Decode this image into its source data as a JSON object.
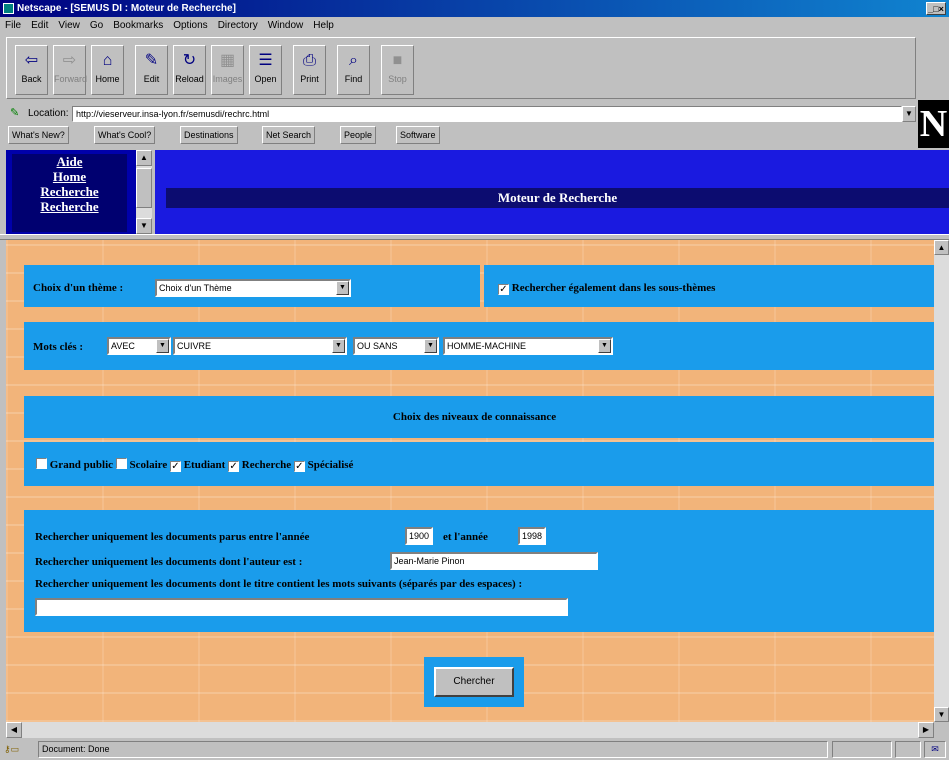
{
  "window": {
    "title": "Netscape - [SEMUS DI : Moteur de Recherche]",
    "controls": "_□×"
  },
  "menu": [
    "File",
    "Edit",
    "View",
    "Go",
    "Bookmarks",
    "Options",
    "Directory",
    "Window",
    "Help"
  ],
  "toolbar": [
    {
      "label": "Back",
      "icon": "⇦",
      "enabled": true
    },
    {
      "label": "Forward",
      "icon": "⇨",
      "enabled": false
    },
    {
      "label": "Home",
      "icon": "⌂",
      "enabled": true
    },
    {
      "label": "Edit",
      "icon": "✎",
      "enabled": true
    },
    {
      "label": "Reload",
      "icon": "↻",
      "enabled": true
    },
    {
      "label": "Images",
      "icon": "▦",
      "enabled": false
    },
    {
      "label": "Open",
      "icon": "☰",
      "enabled": true
    },
    {
      "label": "Print",
      "icon": "⎙",
      "enabled": true
    },
    {
      "label": "Find",
      "icon": "⌕",
      "enabled": true
    },
    {
      "label": "Stop",
      "icon": "■",
      "enabled": false
    }
  ],
  "location": {
    "label": "Location:",
    "url": "http://vieserveur.insa-lyon.fr/semusdi/rechrc.html"
  },
  "directory_buttons": [
    "What's New?",
    "What's Cool?",
    "Destinations",
    "Net Search",
    "People",
    "Software"
  ],
  "logo": "N",
  "left_nav": [
    "Aide",
    "Home",
    "Recherche",
    "Recherche"
  ],
  "header": {
    "title": "Moteur de Recherche"
  },
  "theme": {
    "label": "Choix d'un thème :",
    "value": "Choix d'un Thème",
    "subthemes_label": "Rechercher également dans les sous-thèmes",
    "subthemes_checked": true
  },
  "keywords": {
    "label": "Mots clés :",
    "op1": "AVEC",
    "word1": "CUIVRE",
    "op2": "OU SANS",
    "word2": "HOMME-MACHINE"
  },
  "levels": {
    "title": "Choix des niveaux de connaissance",
    "items": [
      {
        "label": "Grand public",
        "checked": false
      },
      {
        "label": "Scolaire",
        "checked": false
      },
      {
        "label": "Etudiant",
        "checked": true
      },
      {
        "label": "Recherche",
        "checked": true
      },
      {
        "label": "Spécialisé",
        "checked": true
      }
    ]
  },
  "filters": {
    "years_label": "Rechercher uniquement les documents parus entre l'année",
    "year_from": "1900",
    "and_year_label": "et l'année",
    "year_to": "1998",
    "author_label": "Rechercher uniquement les documents dont l'auteur est :",
    "author": "Jean-Marie Pinon",
    "title_label": "Rechercher uniquement les documents dont le titre contient les mots suivants (séparés par des espaces) :",
    "title_words": ""
  },
  "search_button": "Chercher",
  "status": {
    "text": "Document: Done"
  }
}
